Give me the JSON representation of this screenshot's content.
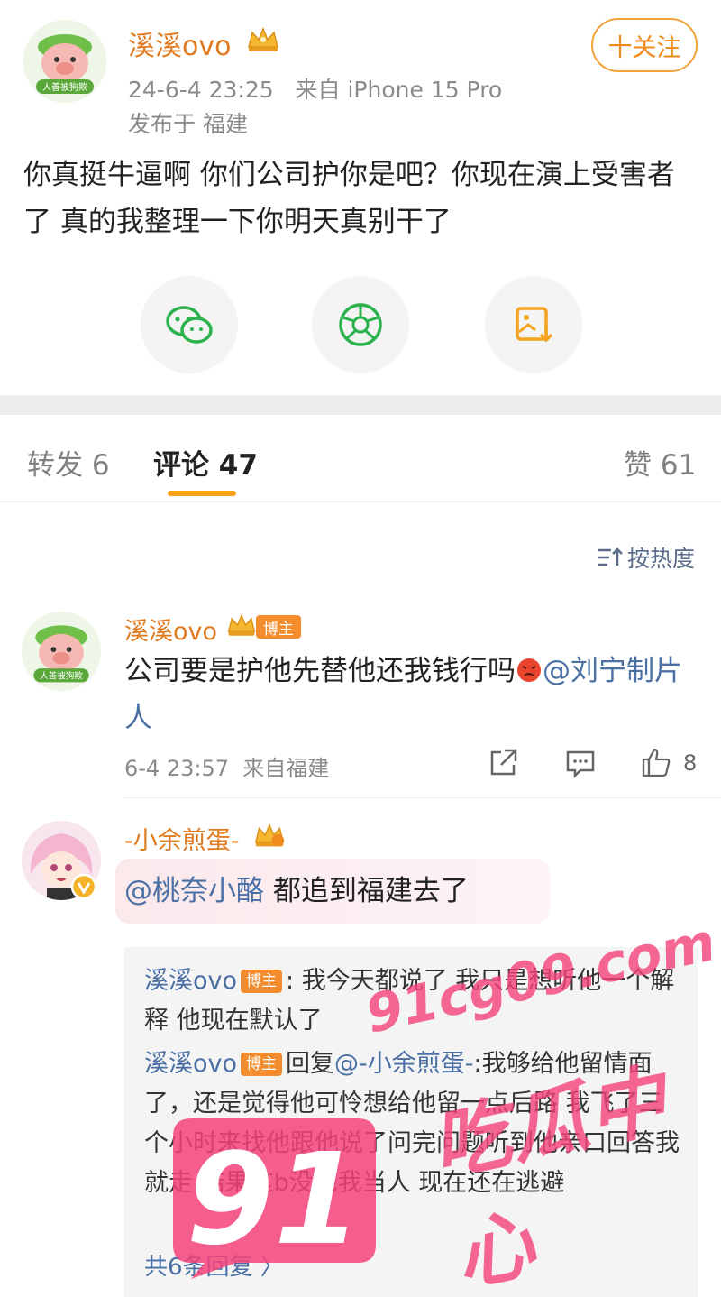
{
  "post": {
    "author": "溪溪ovo",
    "avatar_caption": "人善被狗欺",
    "timestamp": "24-6-4 23:25",
    "source": "来自 iPhone 15 Pro",
    "location": "发布于 福建",
    "follow_label": "十关注",
    "text": "你真挺牛逼啊 你们公司护你是吧？你现在演上受害者了 真的我整理一下你明天真别干了"
  },
  "share": {
    "icons": [
      "wechat-icon",
      "moments-icon",
      "save-image-icon"
    ],
    "colors": {
      "wechat": "#2bb24c",
      "moments": "#2bb24c",
      "save": "#f2a41e"
    }
  },
  "tabs": {
    "repost": "转发 6",
    "comments": "评论 47",
    "likes": "赞 61"
  },
  "sort_label": "按热度",
  "comments": [
    {
      "author": "溪溪ovo",
      "badge": "博主",
      "avatar_caption": "人善被狗欺",
      "text_prefix": "公司要是护他先替他还我钱行吗",
      "mention": "@刘宁制片人",
      "time": "6-4 23:57",
      "location": "来自福建",
      "likes": "8"
    },
    {
      "author": "-小余煎蛋-",
      "mention": "@桃奈小酪",
      "text": " 都追到福建去了",
      "replies": [
        {
          "author": "溪溪ovo",
          "badge": "博主",
          "text": ": 我今天都说了 我只是想听他一个解释 他现在默认了"
        },
        {
          "author": "溪溪ovo",
          "badge": "博主",
          "reply_word": "回复",
          "mention": "@-小余煎蛋-",
          "text": ":我够给他留情面了，还是觉得他可怜想给他留一点后路 我飞了三个小时来找他跟他说了问完问题听到他亲口回答我就走 结果这b没把我当人 现在还在逃避"
        }
      ],
      "more_replies": "共6条回复 〉"
    }
  ],
  "watermark": {
    "logo_number": "91",
    "url": "91cg09.com",
    "name": "吃瓜中心",
    "color": "#f5427a"
  },
  "colors": {
    "accent": "#f7a11a",
    "name_orange": "#e07a1f",
    "link_blue": "#4a6fa5"
  }
}
